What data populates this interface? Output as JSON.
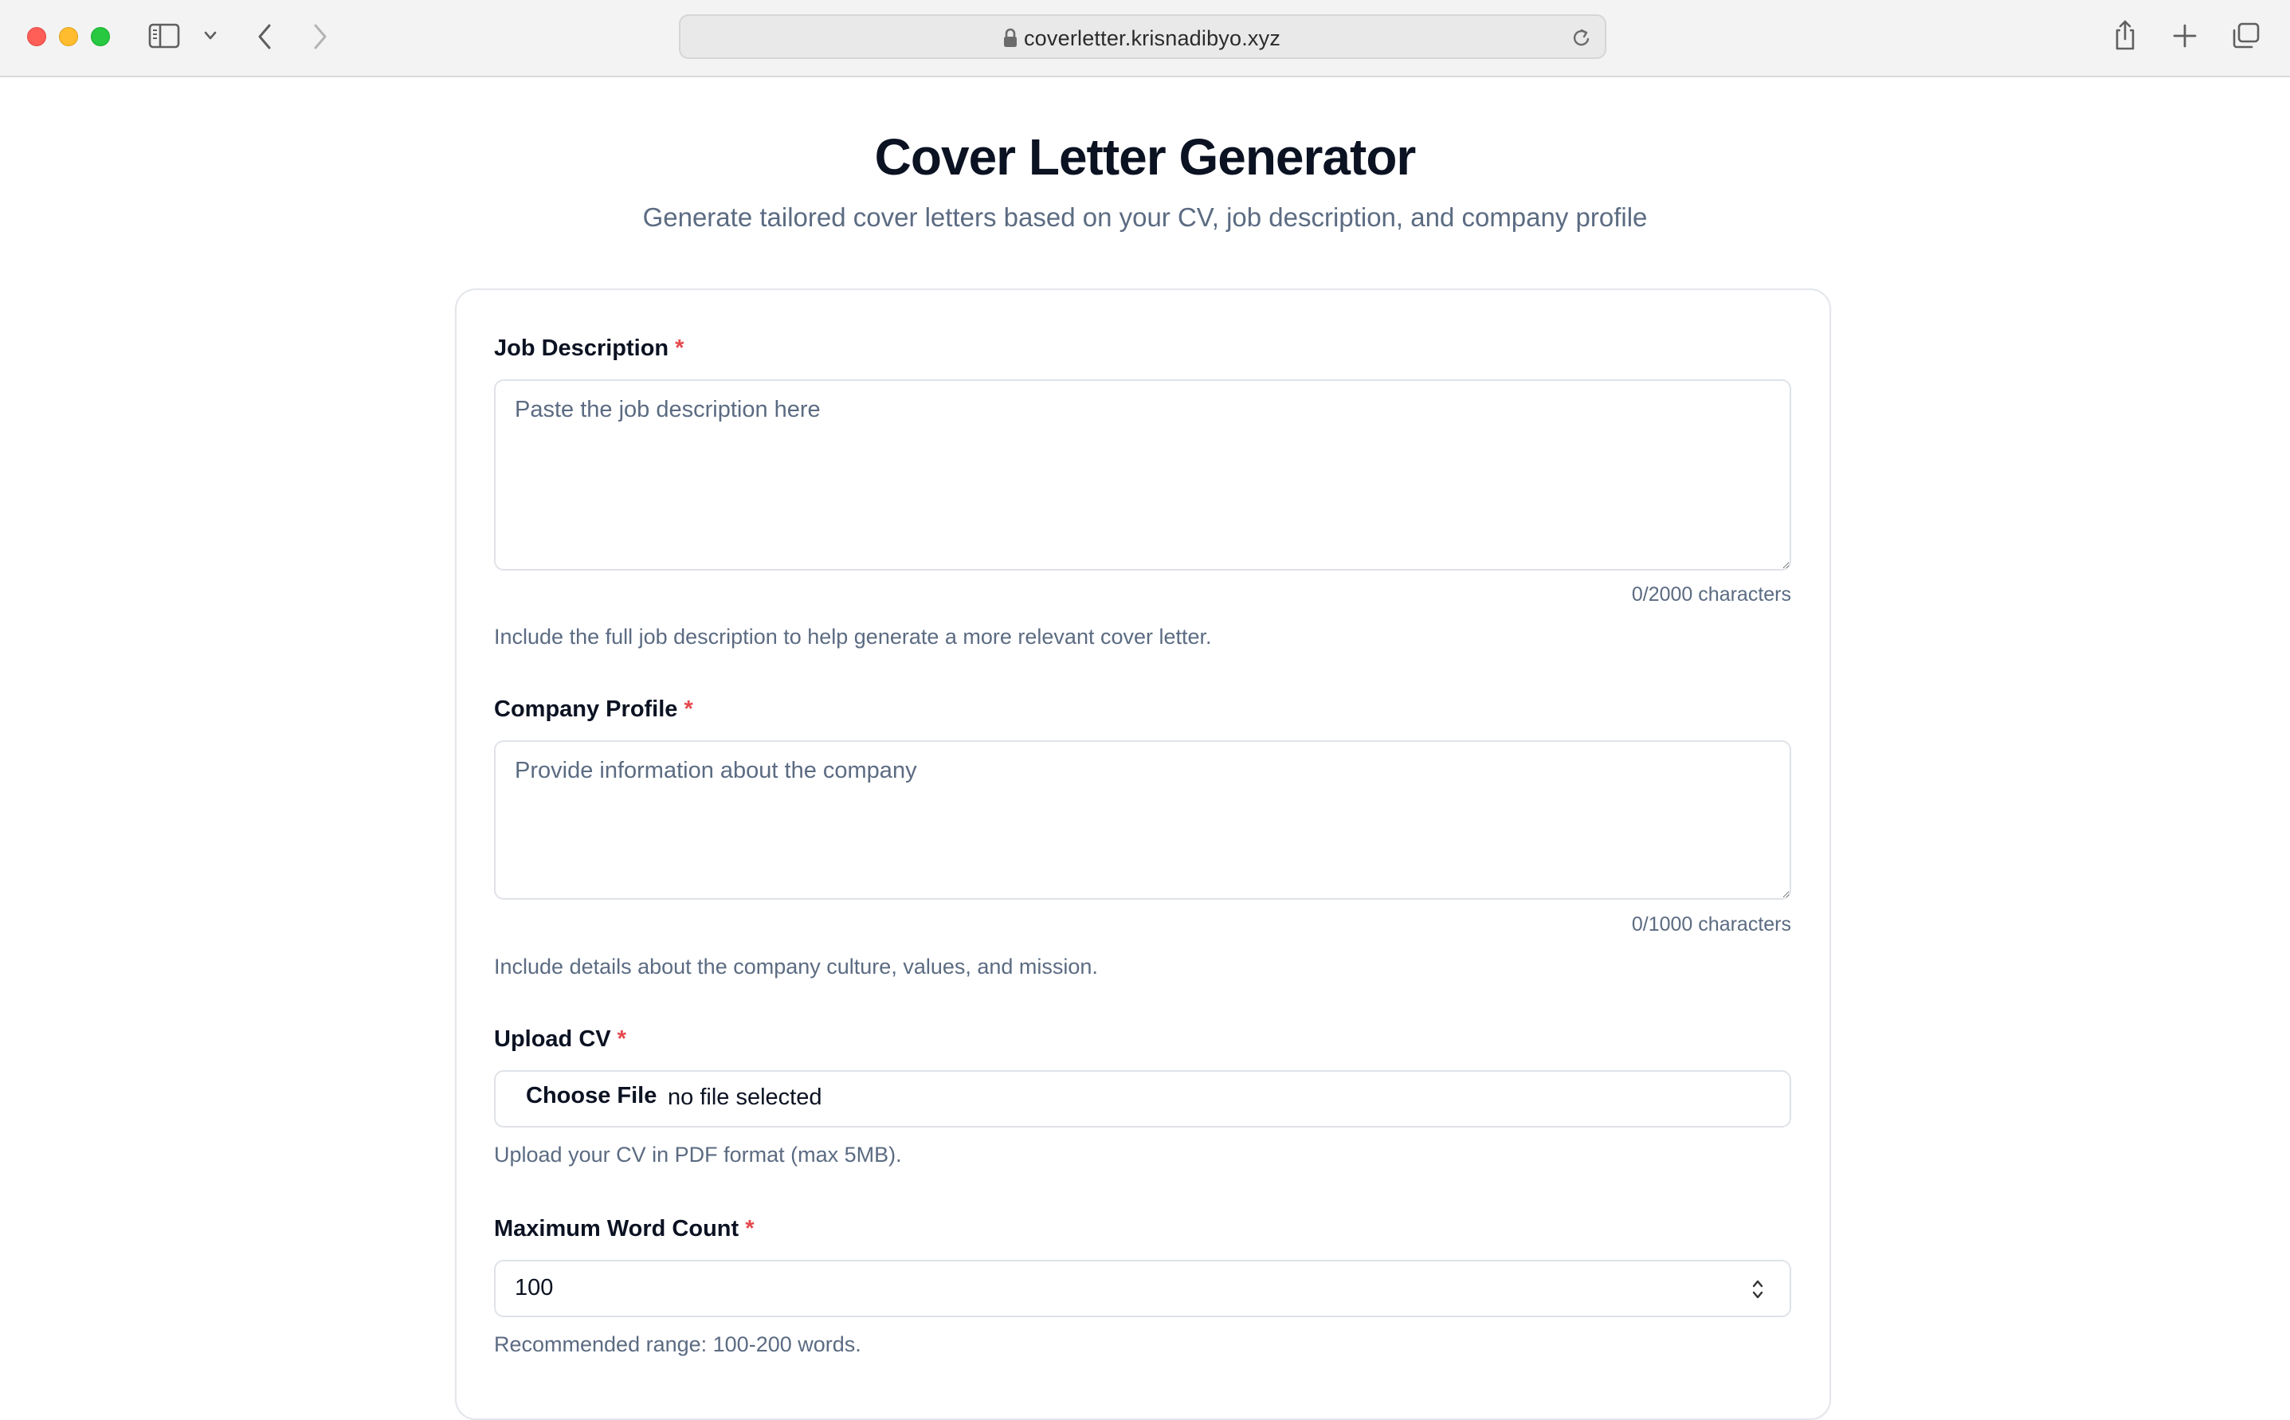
{
  "browser": {
    "url": "coverletter.krisnadibyo.xyz"
  },
  "page": {
    "title": "Cover Letter Generator",
    "subtitle": "Generate tailored cover letters based on your CV, job description, and company profile"
  },
  "form": {
    "required_marker": "*",
    "job_description": {
      "label": "Job Description",
      "placeholder": "Paste the job description here",
      "counter": "0/2000 characters",
      "help": "Include the full job description to help generate a more relevant cover letter."
    },
    "company_profile": {
      "label": "Company Profile",
      "placeholder": "Provide information about the company",
      "counter": "0/1000 characters",
      "help": "Include details about the company culture, values, and mission."
    },
    "upload_cv": {
      "label": "Upload CV",
      "button": "Choose File",
      "status": "no file selected",
      "help": "Upload your CV in PDF format (max 5MB)."
    },
    "max_word_count": {
      "label": "Maximum Word Count",
      "value": "100",
      "help": "Recommended range: 100-200 words."
    }
  },
  "colors": {
    "accent_required": "#e5484d",
    "muted_text": "#5b6b82",
    "heading": "#0b1222"
  }
}
